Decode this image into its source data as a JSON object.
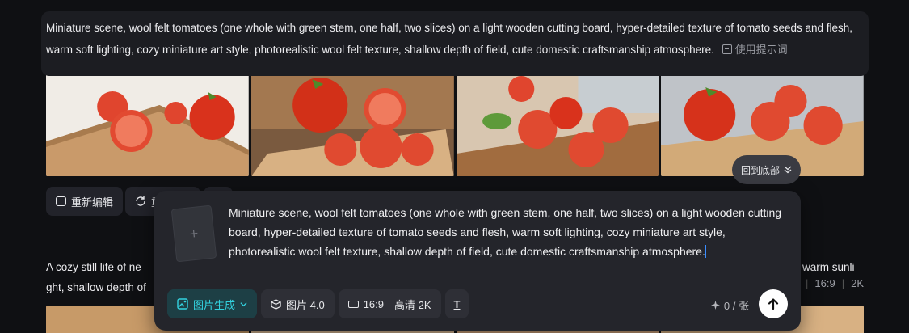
{
  "prompt_banner": {
    "text": "Miniature scene, wool felt tomatoes (one whole with green stem, one half, two slices) on a light wooden cutting board, hyper-detailed texture of tomato seeds and flesh, warm soft lighting, cozy miniature art style, photorealistic wool felt texture, shallow depth of field, cute domestic craftsmanship atmosphere.",
    "use_prompt_label": "使用提示词"
  },
  "actions": {
    "re_edit_label": "重新编辑",
    "regenerate_label": "重"
  },
  "back_to_bottom_label": "回到底部",
  "second_prompt": {
    "text": "A cozy still life of ne",
    "text_line2": "ght, shallow depth of",
    "tail_line1": "warm sunli",
    "ratio": "16:9",
    "quality": "2K"
  },
  "composer": {
    "upload_symbol": "+",
    "input_text": "Miniature scene, wool felt tomatoes (one whole with green stem, one half, two slices) on a light wooden cutting board, hyper-detailed texture of tomato seeds and flesh, warm soft lighting, cozy miniature art style, photorealistic wool felt texture, shallow depth of field, cute domestic craftsmanship atmosphere.",
    "mode_label": "图片生成",
    "model_label": "图片 4.0",
    "ratio_label": "16:9",
    "quality_label": "高清 2K",
    "text_tool_label": "T",
    "credit_text": "0 / 张"
  },
  "colors": {
    "accent": "#33d3e0",
    "background": "#0f1013",
    "panel": "#24252b"
  },
  "icons": [
    "edit-icon",
    "refresh-icon",
    "chevrons-down-icon",
    "image-gen-icon",
    "cube-icon",
    "aspect-ratio-icon",
    "text-format-icon",
    "sparkle-icon",
    "arrow-up-icon"
  ]
}
